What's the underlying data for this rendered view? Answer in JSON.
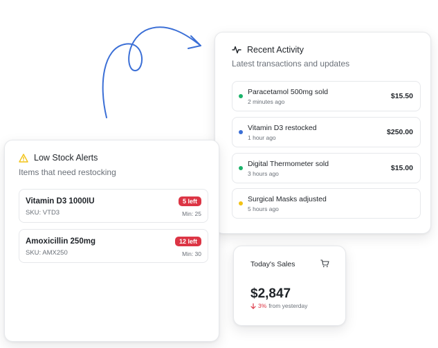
{
  "colors": {
    "accent_blue": "#3b6fd6",
    "success_green": "#1bb36a",
    "warning_yellow": "#f2c215",
    "danger_red": "#dc3545"
  },
  "recent_activity": {
    "title": "Recent Activity",
    "subtitle": "Latest transactions and updates",
    "icon": "activity-pulse-icon",
    "items": [
      {
        "name": "Paracetamol 500mg sold",
        "time": "2 minutes ago",
        "amount": "$15.50",
        "dot": "green"
      },
      {
        "name": "Vitamin D3 restocked",
        "time": "1 hour ago",
        "amount": "$250.00",
        "dot": "blue"
      },
      {
        "name": "Digital Thermometer sold",
        "time": "3 hours ago",
        "amount": "$15.00",
        "dot": "green"
      },
      {
        "name": "Surgical Masks adjusted",
        "time": "5 hours ago",
        "amount": "",
        "dot": "yellow"
      }
    ]
  },
  "low_stock": {
    "title": "Low Stock Alerts",
    "subtitle": "Items that need restocking",
    "icon": "warning-triangle-icon",
    "items": [
      {
        "name": "Vitamin D3 1000IU",
        "sku": "SKU: VTD3",
        "badge": "5 left",
        "min": "Min: 25"
      },
      {
        "name": "Amoxicillin 250mg",
        "sku": "SKU: AMX250",
        "badge": "12 left",
        "min": "Min: 30"
      }
    ]
  },
  "todays_sales": {
    "title": "Today's Sales",
    "icon": "cart-icon",
    "value": "$2,847",
    "change_pct": "3%",
    "change_text": "from yesterday",
    "change_direction": "down"
  }
}
